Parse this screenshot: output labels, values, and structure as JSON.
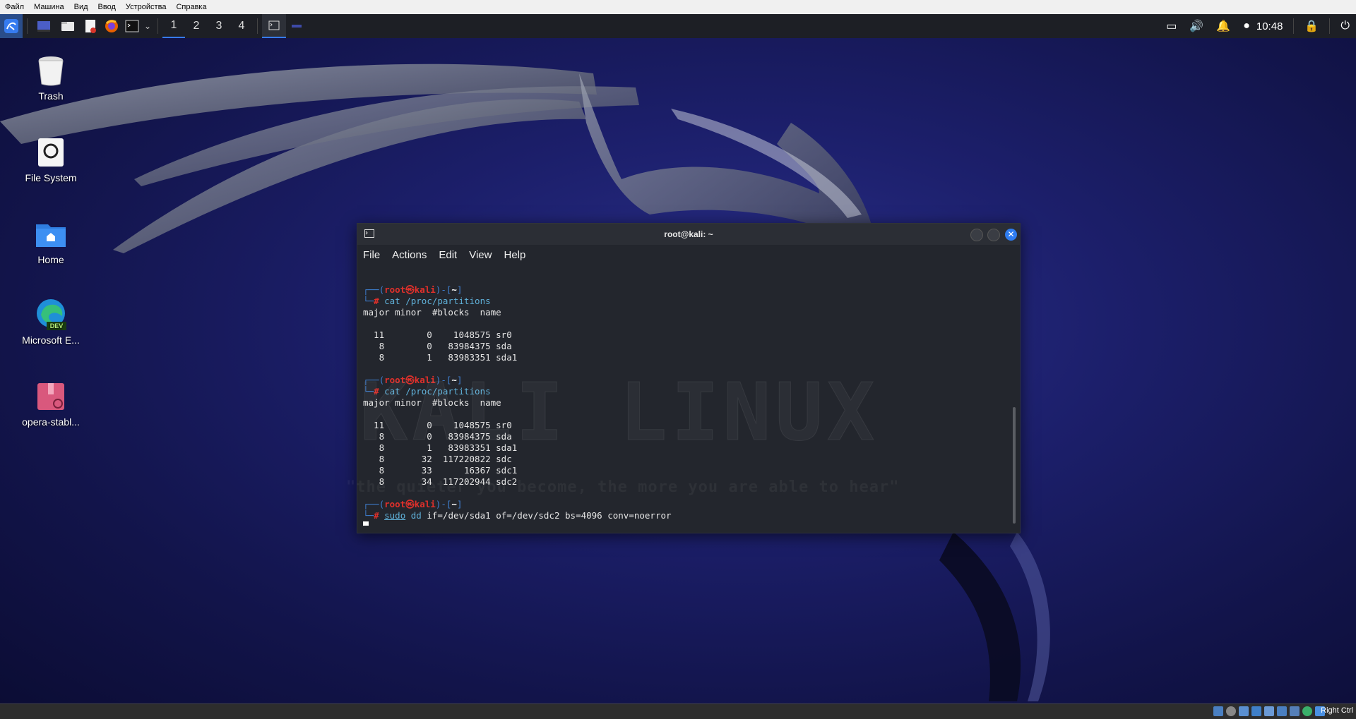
{
  "vbox_menu": [
    "Файл",
    "Машина",
    "Вид",
    "Ввод",
    "Устройства",
    "Справка"
  ],
  "panel": {
    "workspaces": [
      "1",
      "2",
      "3",
      "4"
    ],
    "clock": "10:48"
  },
  "desktop_icons": [
    {
      "label": "Trash",
      "icon": "trash-icon"
    },
    {
      "label": "File System",
      "icon": "drive-icon"
    },
    {
      "label": "Home",
      "icon": "home-folder-icon"
    },
    {
      "label": "Microsoft E...",
      "icon": "edge-dev-icon"
    },
    {
      "label": "opera-stabl...",
      "icon": "package-icon"
    }
  ],
  "terminal": {
    "title": "root@kali: ~",
    "menu": [
      "File",
      "Actions",
      "Edit",
      "View",
      "Help"
    ],
    "prompt_user": "root",
    "prompt_host": "kali",
    "prompt_dir": "~",
    "blocks": [
      {
        "command": "cat /proc/partitions",
        "header": "major minor  #blocks  name",
        "rows": [
          "  11        0    1048575 sr0",
          "   8        0   83984375 sda",
          "   8        1   83983351 sda1"
        ]
      },
      {
        "command": "cat /proc/partitions",
        "header": "major minor  #blocks  name",
        "rows": [
          "  11        0    1048575 sr0",
          "   8        0   83984375 sda",
          "   8        1   83983351 sda1",
          "   8       32  117220822 sdc",
          "   8       33      16367 sdc1",
          "   8       34  117202944 sdc2"
        ]
      }
    ],
    "current_command_prog": "sudo",
    "current_command_tool": "dd",
    "current_command_args": "if=/dev/sda1 of=/dev/sdc2 bs=4096 conv=noerror",
    "watermark": "KALI LINUX",
    "watermark_quote": "\"the quieter you become, the more you are able to hear\""
  },
  "status_bar": {
    "host_key": "Right Ctrl"
  },
  "colors": {
    "accent": "#367bf0",
    "prompt_red": "#e0302b",
    "prompt_blue": "#3f7fd0"
  }
}
